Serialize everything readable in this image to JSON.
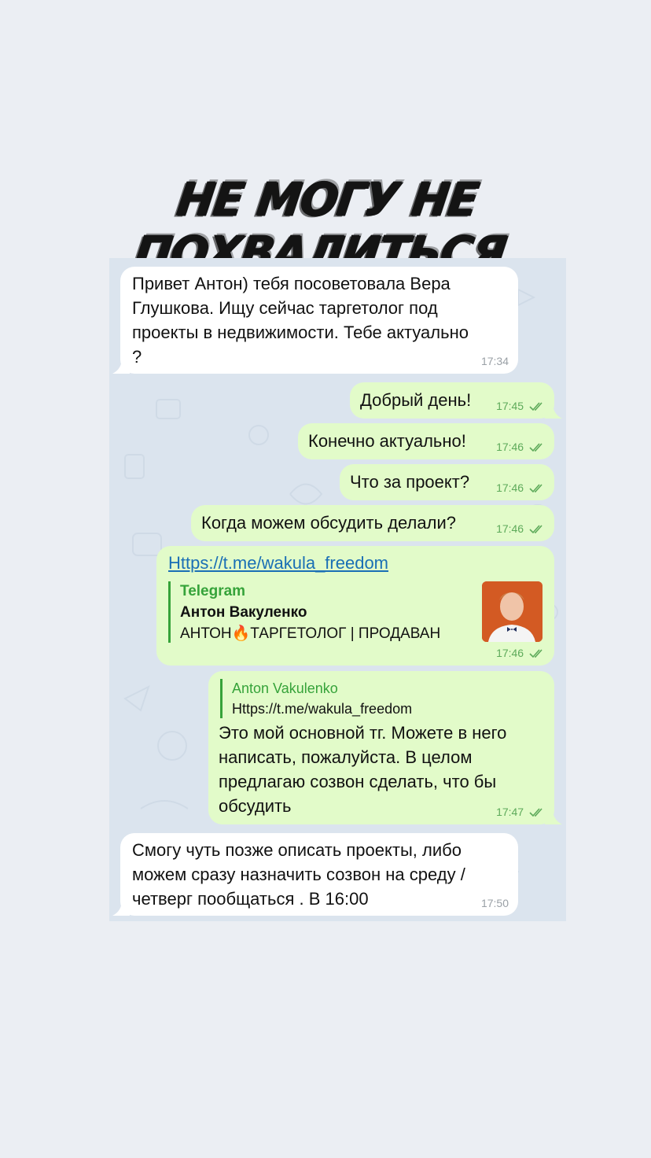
{
  "headline": "НЕ МОГУ НЕ ПОХВАЛИТЬСЯ",
  "messages": [
    {
      "lines": [
        "Привет Антон)  тебя посоветовала Вера",
        "Глушкова. Ищу сейчас таргетолог под",
        "проекты в недвижимости. Тебе актуально",
        "?"
      ],
      "time": "17:34"
    },
    {
      "text": "Добрый день!",
      "time": "17:45"
    },
    {
      "text": "Конечно актуально!",
      "time": "17:46"
    },
    {
      "text": "Что за проект?",
      "time": "17:46"
    },
    {
      "text": "Когда можем обсудить делали?",
      "time": "17:46"
    },
    {
      "link": "Https://t.me/wakula_freedom",
      "preview": {
        "site": "Telegram",
        "title": "Антон Вакуленко",
        "description": "АНТОН🔥ТАРГЕТОЛОГ | ПРОДАВАН"
      },
      "time": "17:46"
    },
    {
      "reply": {
        "name": "Anton Vakulenko",
        "text": "Https://t.me/wakula_freedom"
      },
      "lines": [
        "Это мой основной тг. Можете в него",
        "написать, пожалуйста. В целом",
        "предлагаю созвон сделать, что бы",
        "обсудить"
      ],
      "time": "17:47"
    },
    {
      "lines": [
        "Смогу чуть позже описать проекты, либо",
        "можем сразу назначить созвон на среду /",
        "четверг пообщаться . В 16:00"
      ],
      "time": "17:50"
    }
  ],
  "colors": {
    "page_background": "#ebeef3",
    "chat_background": "#dbe4ee",
    "incoming_bubble": "#ffffff",
    "outgoing_bubble": "#e2fbc9",
    "accent_green": "#36a33a",
    "link_blue": "#1a6fb5"
  },
  "icons": {
    "read_receipt": "double-check-icon",
    "avatar": "profile-photo-thumbnail"
  }
}
